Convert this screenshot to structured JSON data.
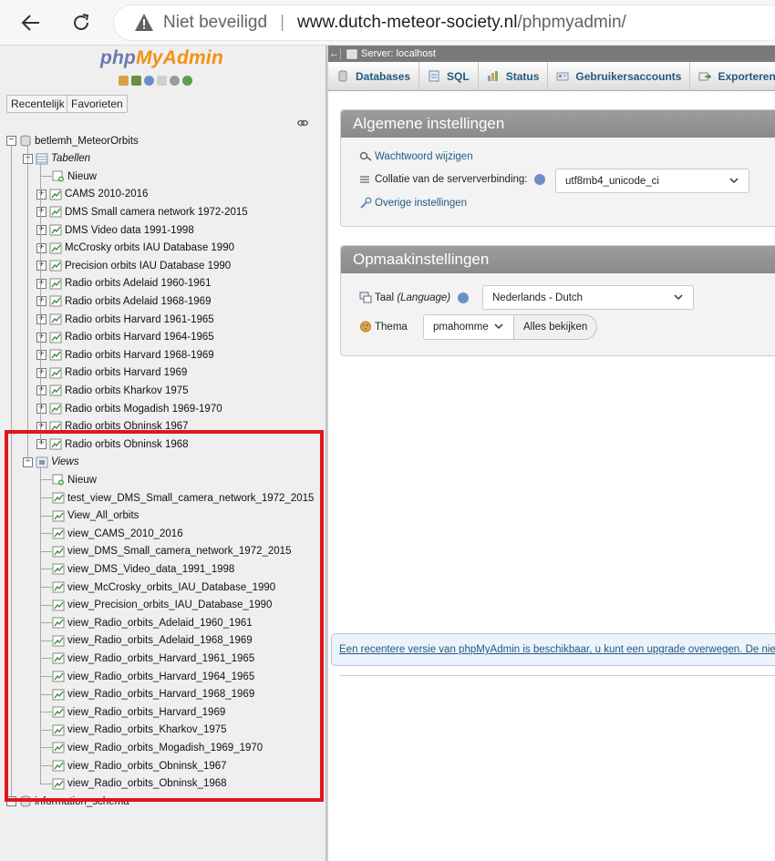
{
  "browser": {
    "not_secure": "Niet beveiligd",
    "url_host": "www.dutch-meteor-society.nl",
    "url_path": "/phpmyadmin/"
  },
  "nav": {
    "logo_php": "php",
    "logo_mya": "MyAdmin",
    "recent_label": "Recentelijk",
    "favorites_label": "Favorieten",
    "db1": "betlemh_MeteorOrbits",
    "tables_label": "Tabellen",
    "new_label": "Nieuw",
    "tables": [
      "CAMS 2010-2016",
      "DMS Small camera network 1972-2015",
      "DMS Video data 1991-1998",
      "McCrosky orbits IAU Database 1990",
      "Precision orbits IAU Database 1990",
      "Radio orbits Adelaid 1960-1961",
      "Radio orbits Adelaid 1968-1969",
      "Radio orbits Harvard 1961-1965",
      "Radio orbits Harvard 1964-1965",
      "Radio orbits Harvard 1968-1969",
      "Radio orbits Harvard 1969",
      "Radio orbits Kharkov 1975",
      "Radio orbits Mogadish 1969-1970",
      "Radio orbits Obninsk 1967",
      "Radio orbits Obninsk 1968"
    ],
    "views_label": "Views",
    "views_new_label": "Nieuw",
    "views": [
      "test_view_DMS_Small_camera_network_1972_2015",
      "View_All_orbits",
      "view_CAMS_2010_2016",
      "view_DMS_Small_camera_network_1972_2015",
      "view_DMS_Video_data_1991_1998",
      "view_McCrosky_orbits_IAU_Database_1990",
      "view_Precision_orbits_IAU_Database_1990",
      "view_Radio_orbits_Adelaid_1960_1961",
      "view_Radio_orbits_Adelaid_1968_1969",
      "view_Radio_orbits_Harvard_1961_1965",
      "view_Radio_orbits_Harvard_1964_1965",
      "view_Radio_orbits_Harvard_1968_1969",
      "view_Radio_orbits_Harvard_1969",
      "view_Radio_orbits_Kharkov_1975",
      "view_Radio_orbits_Mogadish_1969_1970",
      "view_Radio_orbits_Obninsk_1967",
      "view_Radio_orbits_Obninsk_1968"
    ],
    "db2": "information_schema"
  },
  "main": {
    "server_label": "Server: localhost",
    "tabs": [
      "Databases",
      "SQL",
      "Status",
      "Gebruikersaccounts",
      "Exporteren"
    ],
    "general": {
      "title": "Algemene instellingen",
      "change_password": "Wachtwoord wijzigen",
      "collation_label": "Collatie van de serververbinding:",
      "collation_value": "utf8mb4_unicode_ci",
      "more_settings": "Overige instellingen"
    },
    "appearance": {
      "title": "Opmaakinstellingen",
      "language_label": "Taal",
      "language_label_en": "(Language)",
      "language_value": "Nederlands - Dutch",
      "theme_label": "Thema",
      "theme_value": "pmahomme",
      "view_all_label": "Alles bekijken"
    },
    "notice": "Een recentere versie van phpMyAdmin is beschikbaar, u kunt een upgrade overwegen. De nieuwe"
  },
  "colors": {
    "link": "#235a81",
    "highlight": "#e2161b",
    "logo_php": "#6c78af",
    "logo_mya": "#f29111"
  }
}
